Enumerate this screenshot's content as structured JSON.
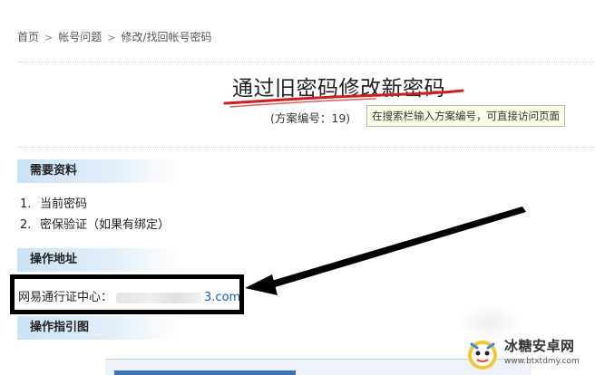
{
  "breadcrumb": {
    "items": [
      "首页",
      "帐号问题",
      "修改/找回帐号密码"
    ],
    "separator": ">"
  },
  "article": {
    "title": "通过旧密码修改新密码",
    "scheme_label": "(方案编号：19)",
    "search_tip": "在搜索栏输入方案编号，可直接访问页面"
  },
  "sections": {
    "required": {
      "heading": "需要资料",
      "items": [
        {
          "num": "1.",
          "text": "当前密码"
        },
        {
          "num": "2.",
          "text": "密保验证（如果有绑定）"
        }
      ]
    },
    "address": {
      "heading": "操作地址",
      "label": "网易通行证中心：",
      "domain_suffix": "3.com"
    },
    "guide": {
      "heading": "操作指引图"
    }
  },
  "watermark": {
    "name": "冰糖安卓网",
    "url": "www.btxtdmy.com"
  },
  "colors": {
    "section_header": "#cbe3f6",
    "annotation_red": "#cc1f1f",
    "link_blue": "#1a5dad",
    "tip_bg": "#fdfde8"
  }
}
